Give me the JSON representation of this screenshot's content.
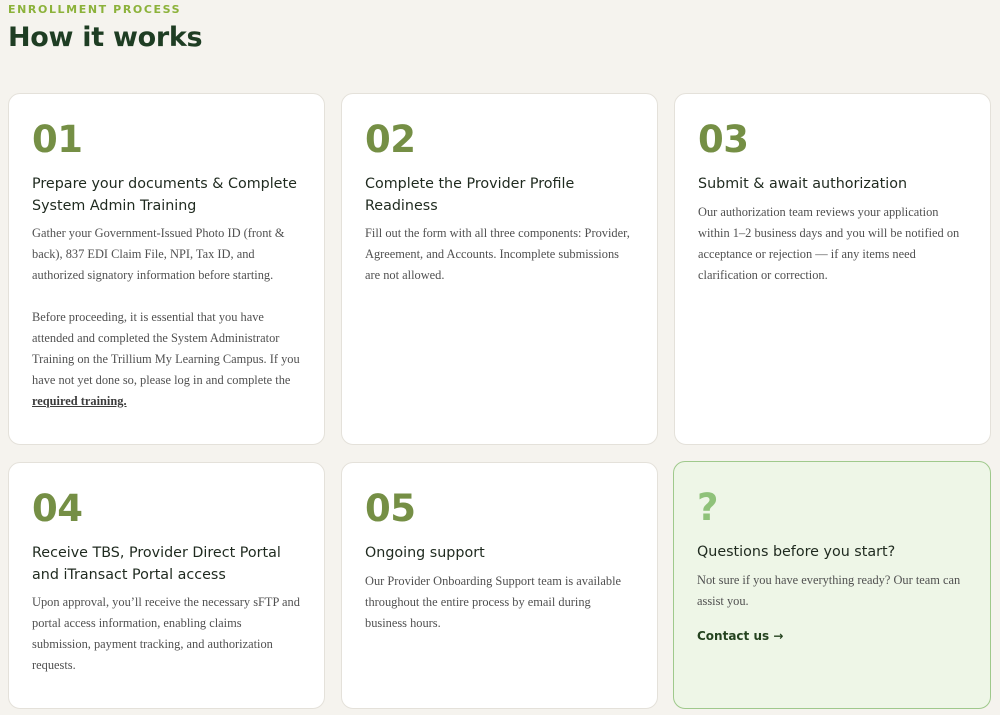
{
  "section": {
    "eyebrow": "ENROLLMENT PROCESS",
    "heading": "How it works"
  },
  "steps": [
    {
      "number": "01",
      "title": "Prepare your documents & Complete System Admin Training",
      "body1": "Gather your Government-Issued Photo ID (front & back), 837 EDI Claim File, NPI, Tax ID, and authorized signatory information before starting.",
      "body2_pre": "Before proceeding, it is essential that you have attended and completed the System Administrator Training on the Trillium My Learning Campus. If you have not yet done so, please log in and complete the ",
      "link": "required training."
    },
    {
      "number": "02",
      "title": "Complete the Provider Profile Readiness",
      "body": "Fill out the form with all three components: Provider, Agreement, and Accounts. Incomplete submissions are not allowed."
    },
    {
      "number": "03",
      "title": "Submit & await authorization",
      "body": "Our authorization team reviews your application within 1–2 business days and you will be notified on acceptance or rejection — if any items need clarification or correction."
    },
    {
      "number": "04",
      "title": "Receive TBS, Provider Direct Portal and iTransact Portal access",
      "body": "Upon approval, you’ll receive the necessary sFTP and portal access information, enabling claims submission, payment tracking, and authorization requests."
    },
    {
      "number": "05",
      "title": "Ongoing support",
      "body": "Our Provider Onboarding Support team is available throughout the entire process by email during business hours."
    }
  ],
  "help": {
    "symbol": "?",
    "title": "Questions before you start?",
    "body": "Not sure if you have everything ready? Our team can assist you.",
    "link": "Contact us →"
  },
  "colors": {
    "accent": "#8cb23a",
    "heading": "#1e3d23",
    "step_number": "#758f45",
    "help_background": "#eef6e7",
    "help_border": "#9fc98c"
  }
}
